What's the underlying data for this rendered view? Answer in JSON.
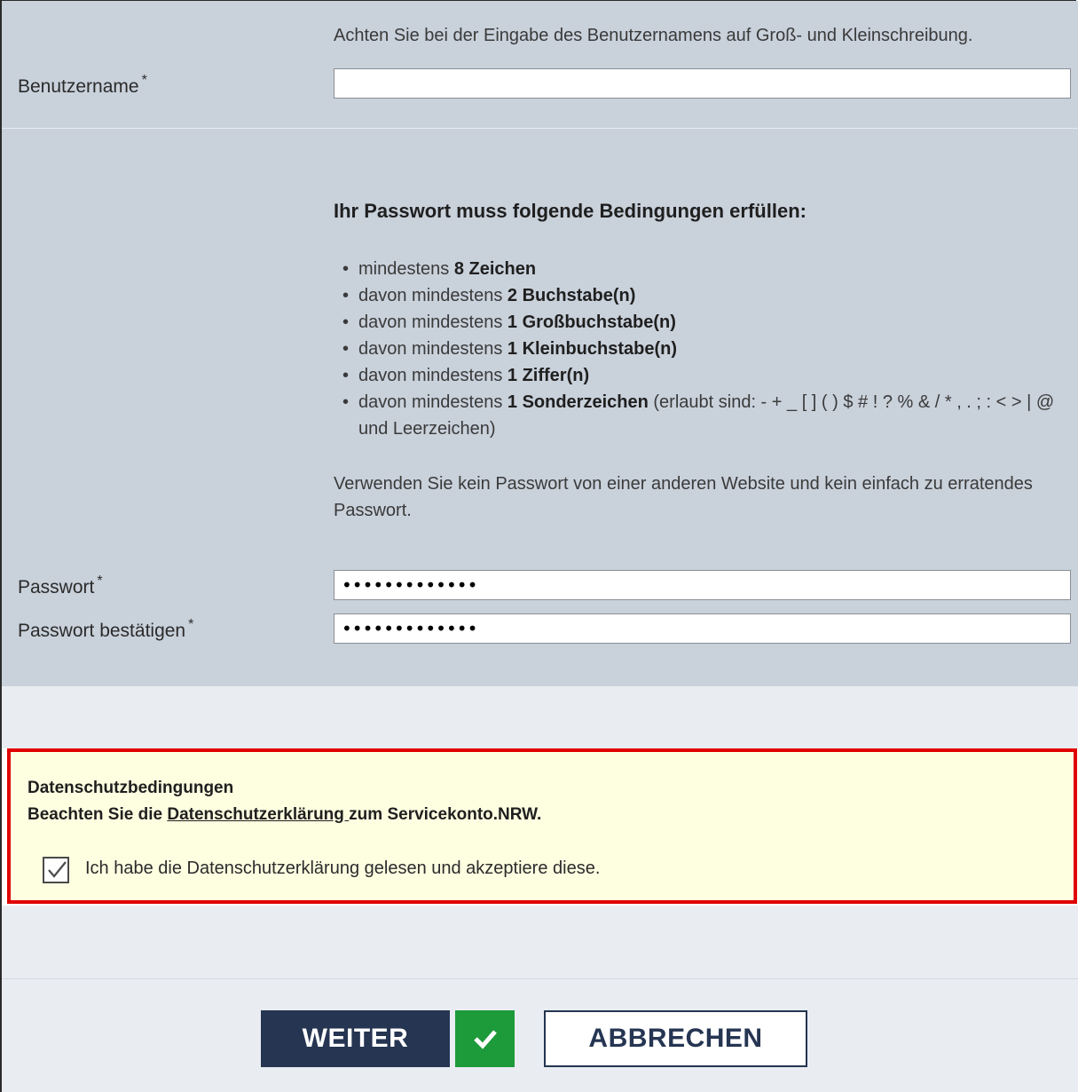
{
  "username": {
    "hint": "Achten Sie bei der Eingabe des Benutzernamens auf Groß- und Kleinschreibung.",
    "label": "Benutzername",
    "required_mark": "*",
    "value": ""
  },
  "password_rules": {
    "heading": "Ihr Passwort muss folgende Bedingungen erfüllen:",
    "items": [
      {
        "prefix": "mindestens ",
        "bold": "8 Zeichen",
        "suffix": ""
      },
      {
        "prefix": "davon mindestens ",
        "bold": "2 Buchstabe(n)",
        "suffix": ""
      },
      {
        "prefix": "davon mindestens ",
        "bold": "1 Großbuchstabe(n)",
        "suffix": ""
      },
      {
        "prefix": "davon mindestens ",
        "bold": "1 Kleinbuchstabe(n)",
        "suffix": ""
      },
      {
        "prefix": "davon mindestens ",
        "bold": "1 Ziffer(n)",
        "suffix": ""
      },
      {
        "prefix": "davon mindestens ",
        "bold": "1 Sonderzeichen",
        "suffix": " (erlaubt sind: - + _ [ ] ( ) $ # ! ? % & / * , . ; : < > | @ und Leerzeichen)"
      }
    ],
    "note": "Verwenden Sie kein Passwort von einer anderen Website und kein einfach zu erratendes Passwort."
  },
  "password": {
    "label": "Passwort",
    "required_mark": "*",
    "masked_value": "•••••••••••••"
  },
  "password_confirm": {
    "label": "Passwort bestätigen",
    "required_mark": "*",
    "masked_value": "•••••••••••••"
  },
  "privacy": {
    "title": "Datenschutzbedingungen",
    "text_before": "Beachten Sie die ",
    "link_text": "Datenschutzerklärung ",
    "text_after": "zum Servicekonto.NRW.",
    "checkbox_label": "Ich habe die Datenschutzerklärung gelesen und akzeptiere diese.",
    "checked": true,
    "highlight_color": "#e00000"
  },
  "actions": {
    "continue_label": "WEITER",
    "cancel_label": "ABBRECHEN",
    "primary_color": "#253552",
    "success_color": "#1d9a3a"
  }
}
